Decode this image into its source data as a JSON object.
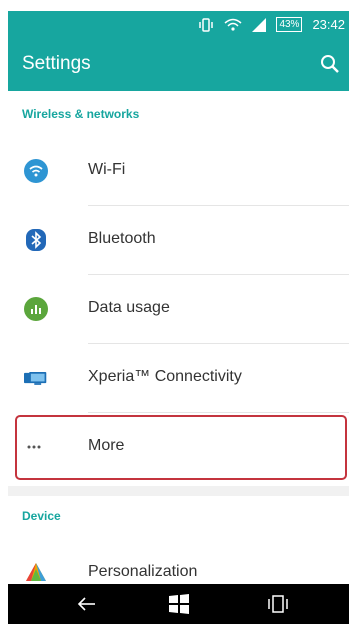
{
  "status": {
    "battery": "43%",
    "time": "23:42"
  },
  "toolbar": {
    "title": "Settings"
  },
  "sections": [
    {
      "header": "Wireless & networks",
      "items": [
        {
          "label": "Wi-Fi",
          "icon": "wifi-icon"
        },
        {
          "label": "Bluetooth",
          "icon": "bluetooth-icon"
        },
        {
          "label": "Data usage",
          "icon": "data-usage-icon"
        },
        {
          "label": "Xperia™ Connectivity",
          "icon": "xperia-connectivity-icon"
        },
        {
          "label": "More",
          "icon": "more-icon"
        }
      ]
    },
    {
      "header": "Device",
      "items": [
        {
          "label": "Personalization",
          "icon": "personalization-icon"
        }
      ]
    }
  ],
  "colors": {
    "accent": "#17a69f",
    "highlight": "#c4343e"
  }
}
